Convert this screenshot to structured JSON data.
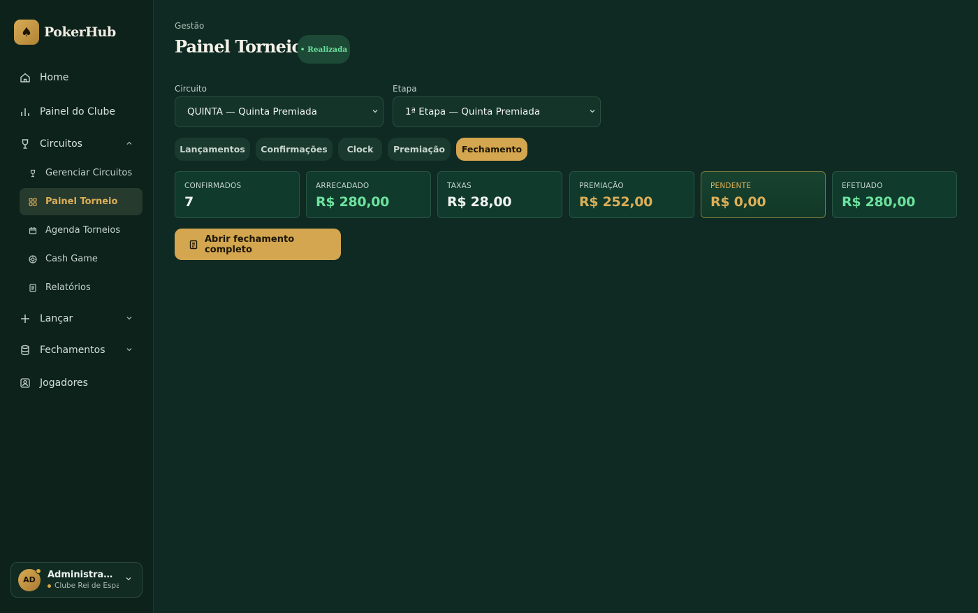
{
  "brand": {
    "name": "PokerHub",
    "icon": "spade-icon"
  },
  "nav": {
    "home": "Home",
    "painel_clube": "Painel do Clube",
    "circuitos": "Circuitos",
    "circuitos_sub": {
      "gerenciar": "Gerenciar Circuitos",
      "painel_torneio": "Painel Torneio",
      "agenda": "Agenda Torneios",
      "cash_game": "Cash Game",
      "relatorios": "Relatórios"
    },
    "lancar": "Lançar",
    "fechamentos": "Fechamentos",
    "jogadores": "Jogadores"
  },
  "user": {
    "initials": "AD",
    "name": "Administrador ...",
    "club": "Clube Rei de Espadas"
  },
  "header": {
    "breadcrumb": "Gestão",
    "title": "Painel Torneio",
    "status": "• Realizada"
  },
  "filters": {
    "circuito_label": "Circuito",
    "circuito_value": "QUINTA — Quinta Premiada",
    "etapa_label": "Etapa",
    "etapa_value": "1ª Etapa — Quinta Premiada"
  },
  "tabs": [
    "Lançamentos",
    "Confirmações",
    "Clock",
    "Premiação",
    "Fechamento"
  ],
  "active_tab": "Fechamento",
  "stats": [
    {
      "label": "CONFIRMADOS",
      "value": "7",
      "color": "#f2f5f2"
    },
    {
      "label": "ARRECADADO",
      "value": "R$ 280,00",
      "color": "#6ee29e"
    },
    {
      "label": "TAXAS",
      "value": "R$ 28,00",
      "color": "#f2f5f2"
    },
    {
      "label": "PREMIAÇÃO",
      "value": "R$ 252,00",
      "color": "#dcaf58"
    },
    {
      "label": "PENDENTE",
      "value": "R$ 0,00",
      "color": "#dcaf58",
      "label_color": "#dcaf58"
    },
    {
      "label": "EFETUADO",
      "value": "R$ 280,00",
      "color": "#6ee29e"
    }
  ],
  "action": {
    "label": "Abrir fechamento completo"
  },
  "colors": {
    "accent": "#d4a64f",
    "positive": "#6ee29e",
    "background": "#0f2a22"
  }
}
